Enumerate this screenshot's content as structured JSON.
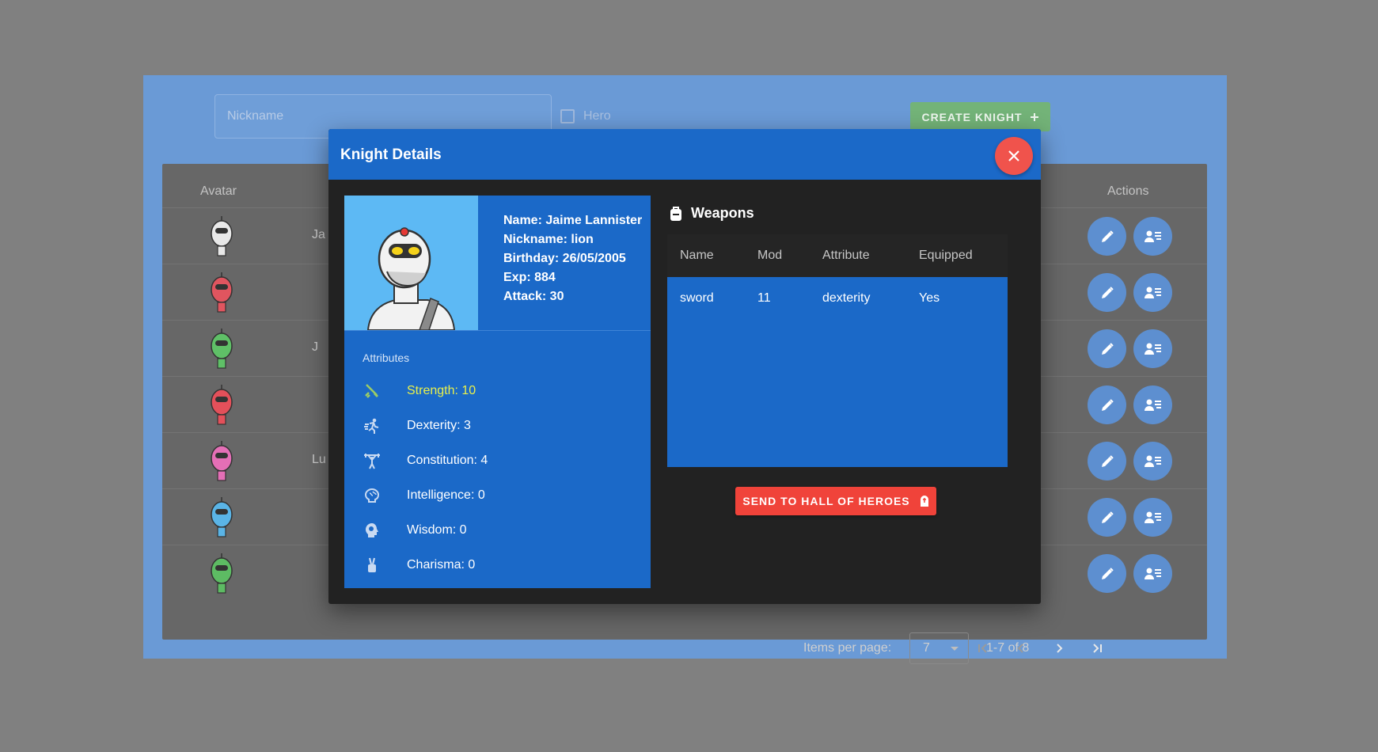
{
  "form": {
    "nickname_placeholder": "Nickname",
    "hero_label": "Hero",
    "create_label": "CREATE KNIGHT",
    "create_icon": "plus-icon"
  },
  "table": {
    "headers": {
      "avatar": "Avatar",
      "actions": "Actions"
    },
    "rows": [
      {
        "name": "Ja",
        "avatar_color": "#e8e8e8"
      },
      {
        "name": "",
        "avatar_color": "#e0555f"
      },
      {
        "name": "J",
        "avatar_color": "#5fc067"
      },
      {
        "name": "",
        "avatar_color": "#e3505a"
      },
      {
        "name": "Lu",
        "avatar_color": "#e46fb6"
      },
      {
        "name": "",
        "avatar_color": "#5ab4e6"
      },
      {
        "name": "",
        "avatar_color": "#5dbb63"
      }
    ]
  },
  "pagination": {
    "items_per_page_label": "Items per page:",
    "items_per_page": "7",
    "range": "1-7 of 8"
  },
  "dialog": {
    "title": "Knight Details",
    "knight": {
      "name": "Name: Jaime Lannister",
      "nickname": "Nickname: lion",
      "birthday": "Birthday: 26/05/2005",
      "exp": "Exp: 884",
      "attack": "Attack: 30"
    },
    "attributes_title": "Attributes",
    "attributes": [
      {
        "label": "Strength: 10",
        "icon": "sword-icon",
        "active": true
      },
      {
        "label": "Dexterity: 3",
        "icon": "running-icon",
        "active": false
      },
      {
        "label": "Constitution: 4",
        "icon": "weightlifter-icon",
        "active": false
      },
      {
        "label": "Intelligence: 0",
        "icon": "brain-icon",
        "active": false
      },
      {
        "label": "Wisdom: 0",
        "icon": "head-gear-icon",
        "active": false
      },
      {
        "label": "Charisma: 0",
        "icon": "peace-hand-icon",
        "active": false
      }
    ],
    "weapons_title": "Weapons",
    "weapons_headers": [
      "Name",
      "Mod",
      "Attribute",
      "Equipped"
    ],
    "weapons": [
      {
        "name": "sword",
        "mod": "11",
        "attribute": "dexterity",
        "equipped": "Yes"
      }
    ],
    "send_label": "SEND TO HALL OF HEROES"
  },
  "colors": {
    "primary": "#1b69c8",
    "danger": "#f0433a",
    "success": "#73b378",
    "highlight": "#e9f04b"
  }
}
